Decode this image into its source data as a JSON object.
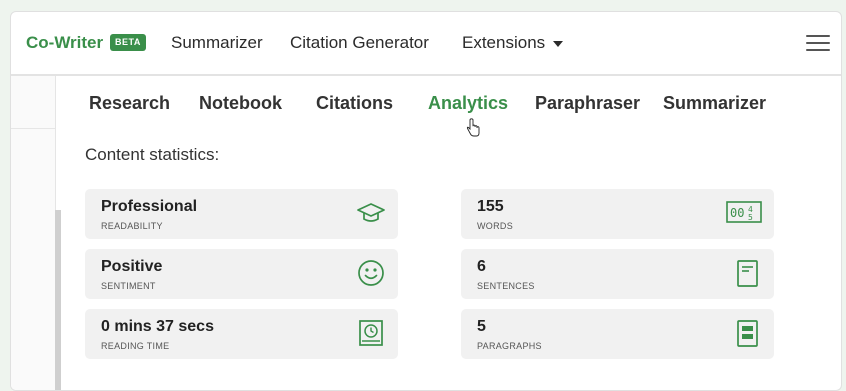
{
  "brand": {
    "name": "Co-Writer",
    "badge": "BETA"
  },
  "nav": {
    "summarizer": "Summarizer",
    "citation_generator": "Citation Generator",
    "extensions": "Extensions"
  },
  "tabs": [
    "Research",
    "Notebook",
    "Citations",
    "Analytics",
    "Paraphraser",
    "Summarizer"
  ],
  "active_tab": "Analytics",
  "section_title": "Content statistics:",
  "stats": {
    "readability": {
      "value": "Professional",
      "label": "READABILITY",
      "icon": "graduation-cap-icon"
    },
    "sentiment": {
      "value": "Positive",
      "label": "SENTIMENT",
      "icon": "smiley-face-icon"
    },
    "reading_time": {
      "value": "0 mins 37 secs",
      "label": "READING TIME",
      "icon": "clock-book-icon"
    },
    "words": {
      "value": "155",
      "label": "WORDS",
      "icon": "word-count-icon"
    },
    "sentences": {
      "value": "6",
      "label": "SENTENCES",
      "icon": "document-lines-icon"
    },
    "paragraphs": {
      "value": "5",
      "label": "PARAGRAPHS",
      "icon": "document-block-icon"
    }
  },
  "colors": {
    "accent": "#3a8f4a",
    "text": "#2b2b2b",
    "card_bg": "#f1f1f1"
  }
}
